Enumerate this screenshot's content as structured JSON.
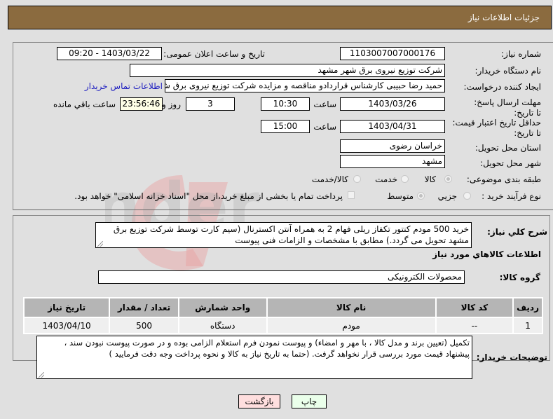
{
  "header": {
    "title": "جزئیات اطلاعات نیاز"
  },
  "form": {
    "need_number": {
      "label": "شماره نیاز:",
      "value": "1103007007000176"
    },
    "announce_datetime": {
      "label": "تاریخ و ساعت اعلان عمومی:",
      "value": "1403/03/22 - 09:20"
    },
    "buyer_org": {
      "label": "نام دستگاه خریدار:",
      "value": "شرکت توزیع نیروی برق شهر مشهد"
    },
    "requester": {
      "label": "ایجاد کننده درخواست:",
      "value": "حمید رضا  حبیبی کارشناس قراردادو مناقصه و مزایده  شرکت توزیع نیروی برق ش",
      "contact_link": "اطلاعات تماس خریدار"
    },
    "response_deadline": {
      "label": "مهلت ارسال پاسخ: تا تاریخ:",
      "date": "1403/03/26",
      "time_label": "ساعت",
      "time": "10:30",
      "days": "3",
      "days_label": "روز و",
      "remaining": "23:56:46",
      "remaining_label": "ساعت باقي مانده"
    },
    "price_validity": {
      "label": "حداقل تاریخ اعتبار قیمت: تا تاریخ:",
      "date": "1403/04/31",
      "time_label": "ساعت",
      "time": "15:00"
    },
    "delivery_province": {
      "label": "استان محل تحویل:",
      "value": "خراسان رضوی"
    },
    "delivery_city": {
      "label": "شهر محل تحویل:",
      "value": "مشهد"
    },
    "category": {
      "label": "طبقه بندی موضوعی:",
      "options": [
        {
          "label": "کالا",
          "selected": true
        },
        {
          "label": "خدمت",
          "selected": false
        },
        {
          "label": "کالا/خدمت",
          "selected": false
        }
      ]
    },
    "purchase_type": {
      "label": "نوع فرآیند خرید :",
      "options": [
        {
          "label": "جزیي",
          "selected": false
        },
        {
          "label": "متوسط",
          "selected": true
        }
      ],
      "treasury_checkbox": {
        "label": "پرداخت تمام یا بخشی از مبلغ خرید،از محل \"اسناد خزانه اسلامی\" خواهد بود.",
        "checked": false
      }
    }
  },
  "description": {
    "label": "شرح کلي نیاز:",
    "value": "خرید 500 مودم کنتور تکفاز ریلی فهام 2 به همراه آنتن اکسترنال (سیم کارت توسط شرکت توزیع برق مشهد تحویل می گردد.) مطابق با مشخصات و الزامات فنی پیوست"
  },
  "goods_section": {
    "title": "اطلاعات کالاهاي مورد نیاز",
    "group_label": "گروه کالا:",
    "group_value": "محصولات الکترونیکی",
    "table": {
      "columns": [
        "ردیف",
        "کد کالا",
        "نام کالا",
        "واحد شمارش",
        "تعداد / مقدار",
        "تاریخ نیاز"
      ],
      "rows": [
        [
          "1",
          "--",
          "مودم",
          "دستگاه",
          "500",
          "1403/04/10"
        ]
      ]
    }
  },
  "buyer_notes": {
    "label": "توضیحات خریدار:",
    "value": "تکمیل (تعیین برند و مدل کالا ، با مهر و امضاء) و پیوست نمودن فرم استعلام الزامی بوده و در صورت پیوست نبودن سند ، پیشنهاد قیمت مورد بررسی قرار نخواهد گرفت. (حتما به تاریخ نیاز به کالا و نحوه پرداخت وجه دقت فرمایید )"
  },
  "buttons": {
    "print": "چاپ",
    "back": "بازگشت"
  },
  "colors": {
    "header_bg": "#8b6b3f",
    "link": "#2020c0",
    "print_bg": "#eaffea",
    "back_bg": "#ffdede"
  }
}
